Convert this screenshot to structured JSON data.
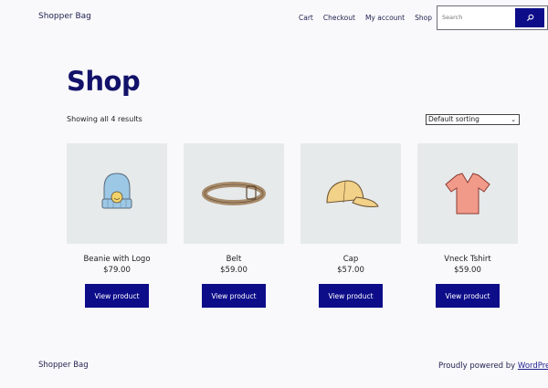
{
  "header": {
    "site_title": "Shopper Bag",
    "nav": [
      "Cart",
      "Checkout",
      "My account",
      "Shop"
    ],
    "search_placeholder": "Search"
  },
  "main": {
    "title": "Shop",
    "result_count": "Showing all 4 results",
    "sort_selected": "Default sorting",
    "products": [
      {
        "name": "Beanie with Logo",
        "price": "$79.00",
        "button": "View product"
      },
      {
        "name": "Belt",
        "price": "$59.00",
        "button": "View product"
      },
      {
        "name": "Cap",
        "price": "$57.00",
        "button": "View product"
      },
      {
        "name": "Vneck Tshirt",
        "price": "$59.00",
        "button": "View product"
      }
    ]
  },
  "footer": {
    "site_title": "Shopper Bag",
    "powered_prefix": "Proudly powered by ",
    "powered_link": "WordPress"
  },
  "colors": {
    "accent": "#0d0d8a",
    "title": "#12126a",
    "thumb_bg": "#e6eaeb"
  }
}
